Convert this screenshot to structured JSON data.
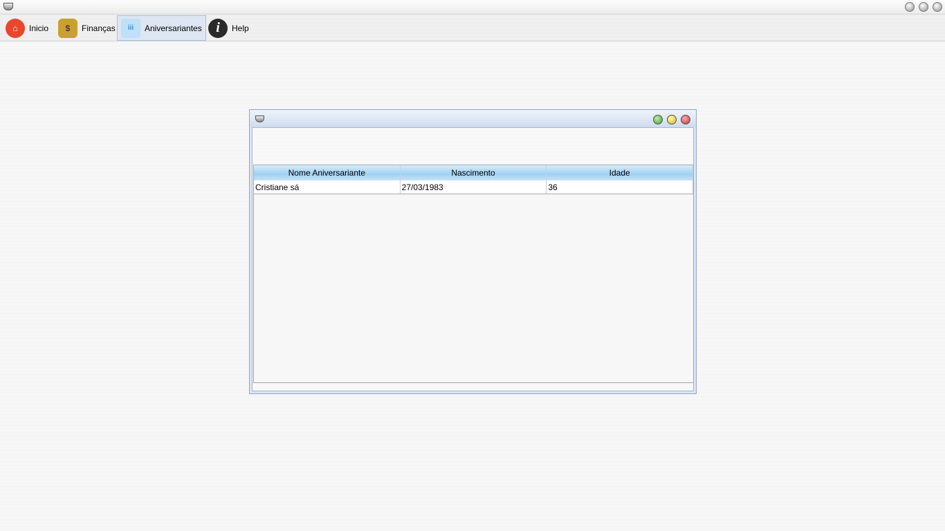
{
  "app": {
    "window_controls": [
      "minimize",
      "maximize",
      "close"
    ]
  },
  "toolbar": {
    "items": [
      {
        "label": "Inicio",
        "icon": "home-icon"
      },
      {
        "label": "Finanças",
        "icon": "coins-icon"
      },
      {
        "label": "Aniversariantes",
        "icon": "cake-icon",
        "selected": true
      },
      {
        "label": "Help",
        "icon": "info-icon"
      }
    ]
  },
  "frame": {
    "controls": [
      "iconify",
      "maximize",
      "close"
    ],
    "table": {
      "columns": [
        "Nome Aniversariante",
        "Nascimento",
        "Idade"
      ],
      "rows": [
        [
          "Cristiane sá",
          "27/03/1983",
          "36"
        ]
      ]
    }
  }
}
